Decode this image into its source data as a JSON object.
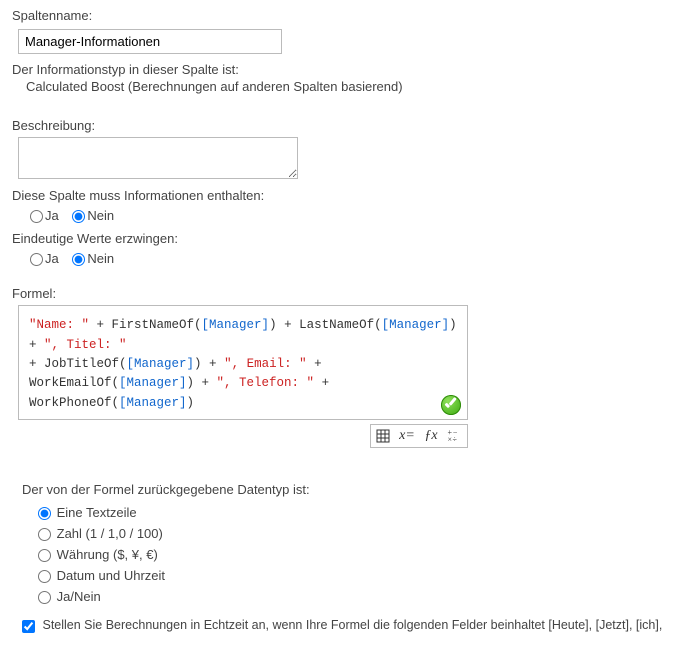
{
  "columnName": {
    "label": "Spaltenname:",
    "value": "Manager-Informationen"
  },
  "infoType": {
    "label": "Der Informationstyp in dieser Spalte ist:",
    "value": "Calculated Boost (Berechnungen auf anderen Spalten basierend)"
  },
  "description": {
    "label": "Beschreibung:",
    "value": ""
  },
  "required": {
    "label": "Diese Spalte muss Informationen enthalten:",
    "yes": "Ja",
    "no": "Nein"
  },
  "unique": {
    "label": "Eindeutige Werte erzwingen:",
    "yes": "Ja",
    "no": "Nein"
  },
  "formula": {
    "label": "Formel:",
    "parts": {
      "s1": "\"Name: \"",
      "p1": " + FirstNameOf(",
      "b1": "[Manager]",
      "p2": ") + LastNameOf(",
      "b2": "[Manager]",
      "p3": ") + ",
      "s2": "\", Titel: \"",
      "p4": " + JobTitleOf(",
      "b3": "[Manager]",
      "p5": ") + ",
      "s3": "\", Email: \"",
      "p6": " + WorkEmailOf(",
      "b4": "[Manager]",
      "p7": ") + ",
      "s4": "\", Telefon: \"",
      "p8": " + WorkPhoneOf(",
      "b5": "[Manager]",
      "p9": ")"
    }
  },
  "datatype": {
    "label": "Der von der Formel zurückgegebene Datentyp ist:",
    "options": [
      "Eine Textzeile",
      "Zahl (1 / 1,0 / 100)",
      "Währung ($, ¥, €)",
      "Datum und Uhrzeit",
      "Ja/Nein"
    ]
  },
  "realtime": {
    "label": "Stellen Sie Berechnungen in Echtzeit an, wenn Ihre Formel die folgenden Felder beinhaltet [Heute], [Jetzt], [ich],"
  }
}
